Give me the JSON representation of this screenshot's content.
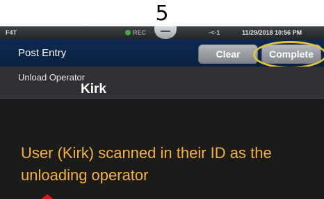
{
  "step": {
    "number": "5"
  },
  "status_bar": {
    "device": "F4T",
    "rec": "REC",
    "connection": "-<-1",
    "datetime": "11/29/2018 10:56 PM"
  },
  "header": {
    "title": "Post Entry",
    "clear_label": "Clear",
    "complete_label": "Complete"
  },
  "operator": {
    "label": "Unload Operator",
    "value": "Kirk"
  },
  "annotation": {
    "caption": "User (Kirk) scanned in their  ID as the unloading operator",
    "highlight_color": "#e5c33a",
    "caption_color": "#f0b23a",
    "arrow_color": "#e0141b"
  }
}
